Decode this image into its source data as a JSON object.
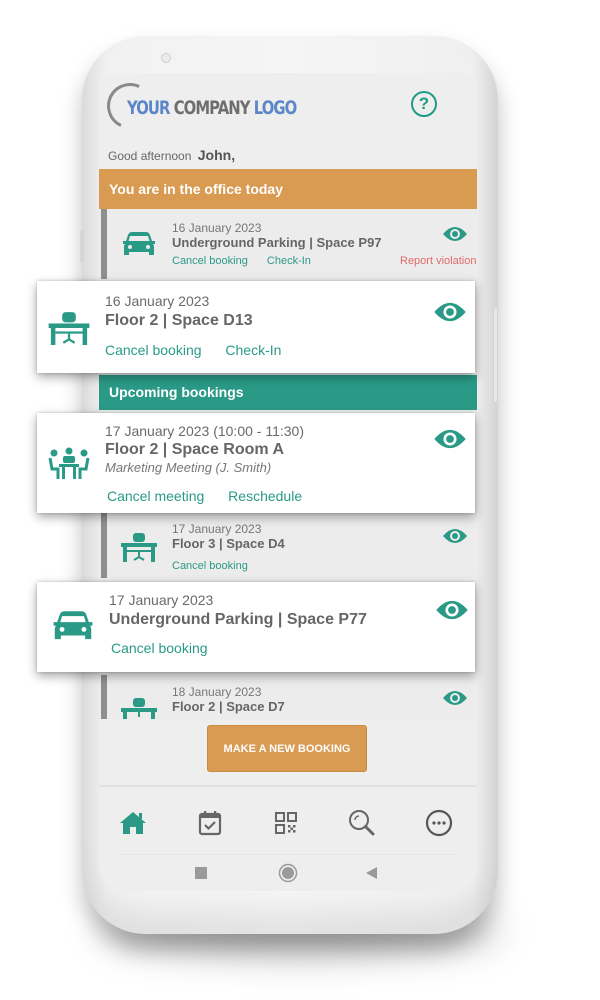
{
  "header": {
    "logo_word1": "YOUR",
    "logo_word2": "COMPANY",
    "logo_word3": "LOGO",
    "help_icon": "help-circle-icon",
    "greeting_prefix": "Good afternoon",
    "greeting_name": "John,"
  },
  "colors": {
    "accent_teal": "#2a9a87",
    "accent_orange": "#d99a52",
    "danger": "#e06a6a",
    "logo_blue": "#5b86c8"
  },
  "today": {
    "title": "You are in the office today",
    "bookings": [
      {
        "icon": "car-icon",
        "date": "16 January 2023",
        "title": "Underground Parking | Space P97",
        "actions": [
          "Cancel booking",
          "Check-In",
          "Report violation"
        ]
      },
      {
        "icon": "desk-icon",
        "date": "16 January 2023",
        "title": "Floor 2 | Space D13",
        "actions": [
          "Cancel booking",
          "Check-In"
        ]
      }
    ]
  },
  "upcoming": {
    "title": "Upcoming bookings",
    "bookings": [
      {
        "icon": "meeting-icon",
        "date": "17 January 2023 (10:00 - 11:30)",
        "title": "Floor 2 | Space Room A",
        "subtitle": "Marketing Meeting (J. Smith)",
        "actions": [
          "Cancel meeting",
          "Reschedule"
        ]
      },
      {
        "icon": "desk-icon",
        "date": "17 January 2023",
        "title": "Floor 3 | Space D4",
        "actions": [
          "Cancel booking"
        ]
      },
      {
        "icon": "car-icon",
        "date": "17 January 2023",
        "title": "Underground Parking | Space P77",
        "actions": [
          "Cancel booking"
        ]
      },
      {
        "icon": "desk-icon",
        "date": "18 January 2023",
        "title": "Floor 2 | Space D7",
        "actions": []
      }
    ]
  },
  "new_booking_label": "MAKE A NEW BOOKING",
  "bottom_nav": [
    {
      "icon": "home-icon",
      "active": true
    },
    {
      "icon": "calendar-check-icon",
      "active": false
    },
    {
      "icon": "qr-code-icon",
      "active": false
    },
    {
      "icon": "search-icon",
      "active": false
    },
    {
      "icon": "more-icon",
      "active": false
    }
  ],
  "system_nav": [
    "recents-button",
    "home-button",
    "back-button"
  ]
}
